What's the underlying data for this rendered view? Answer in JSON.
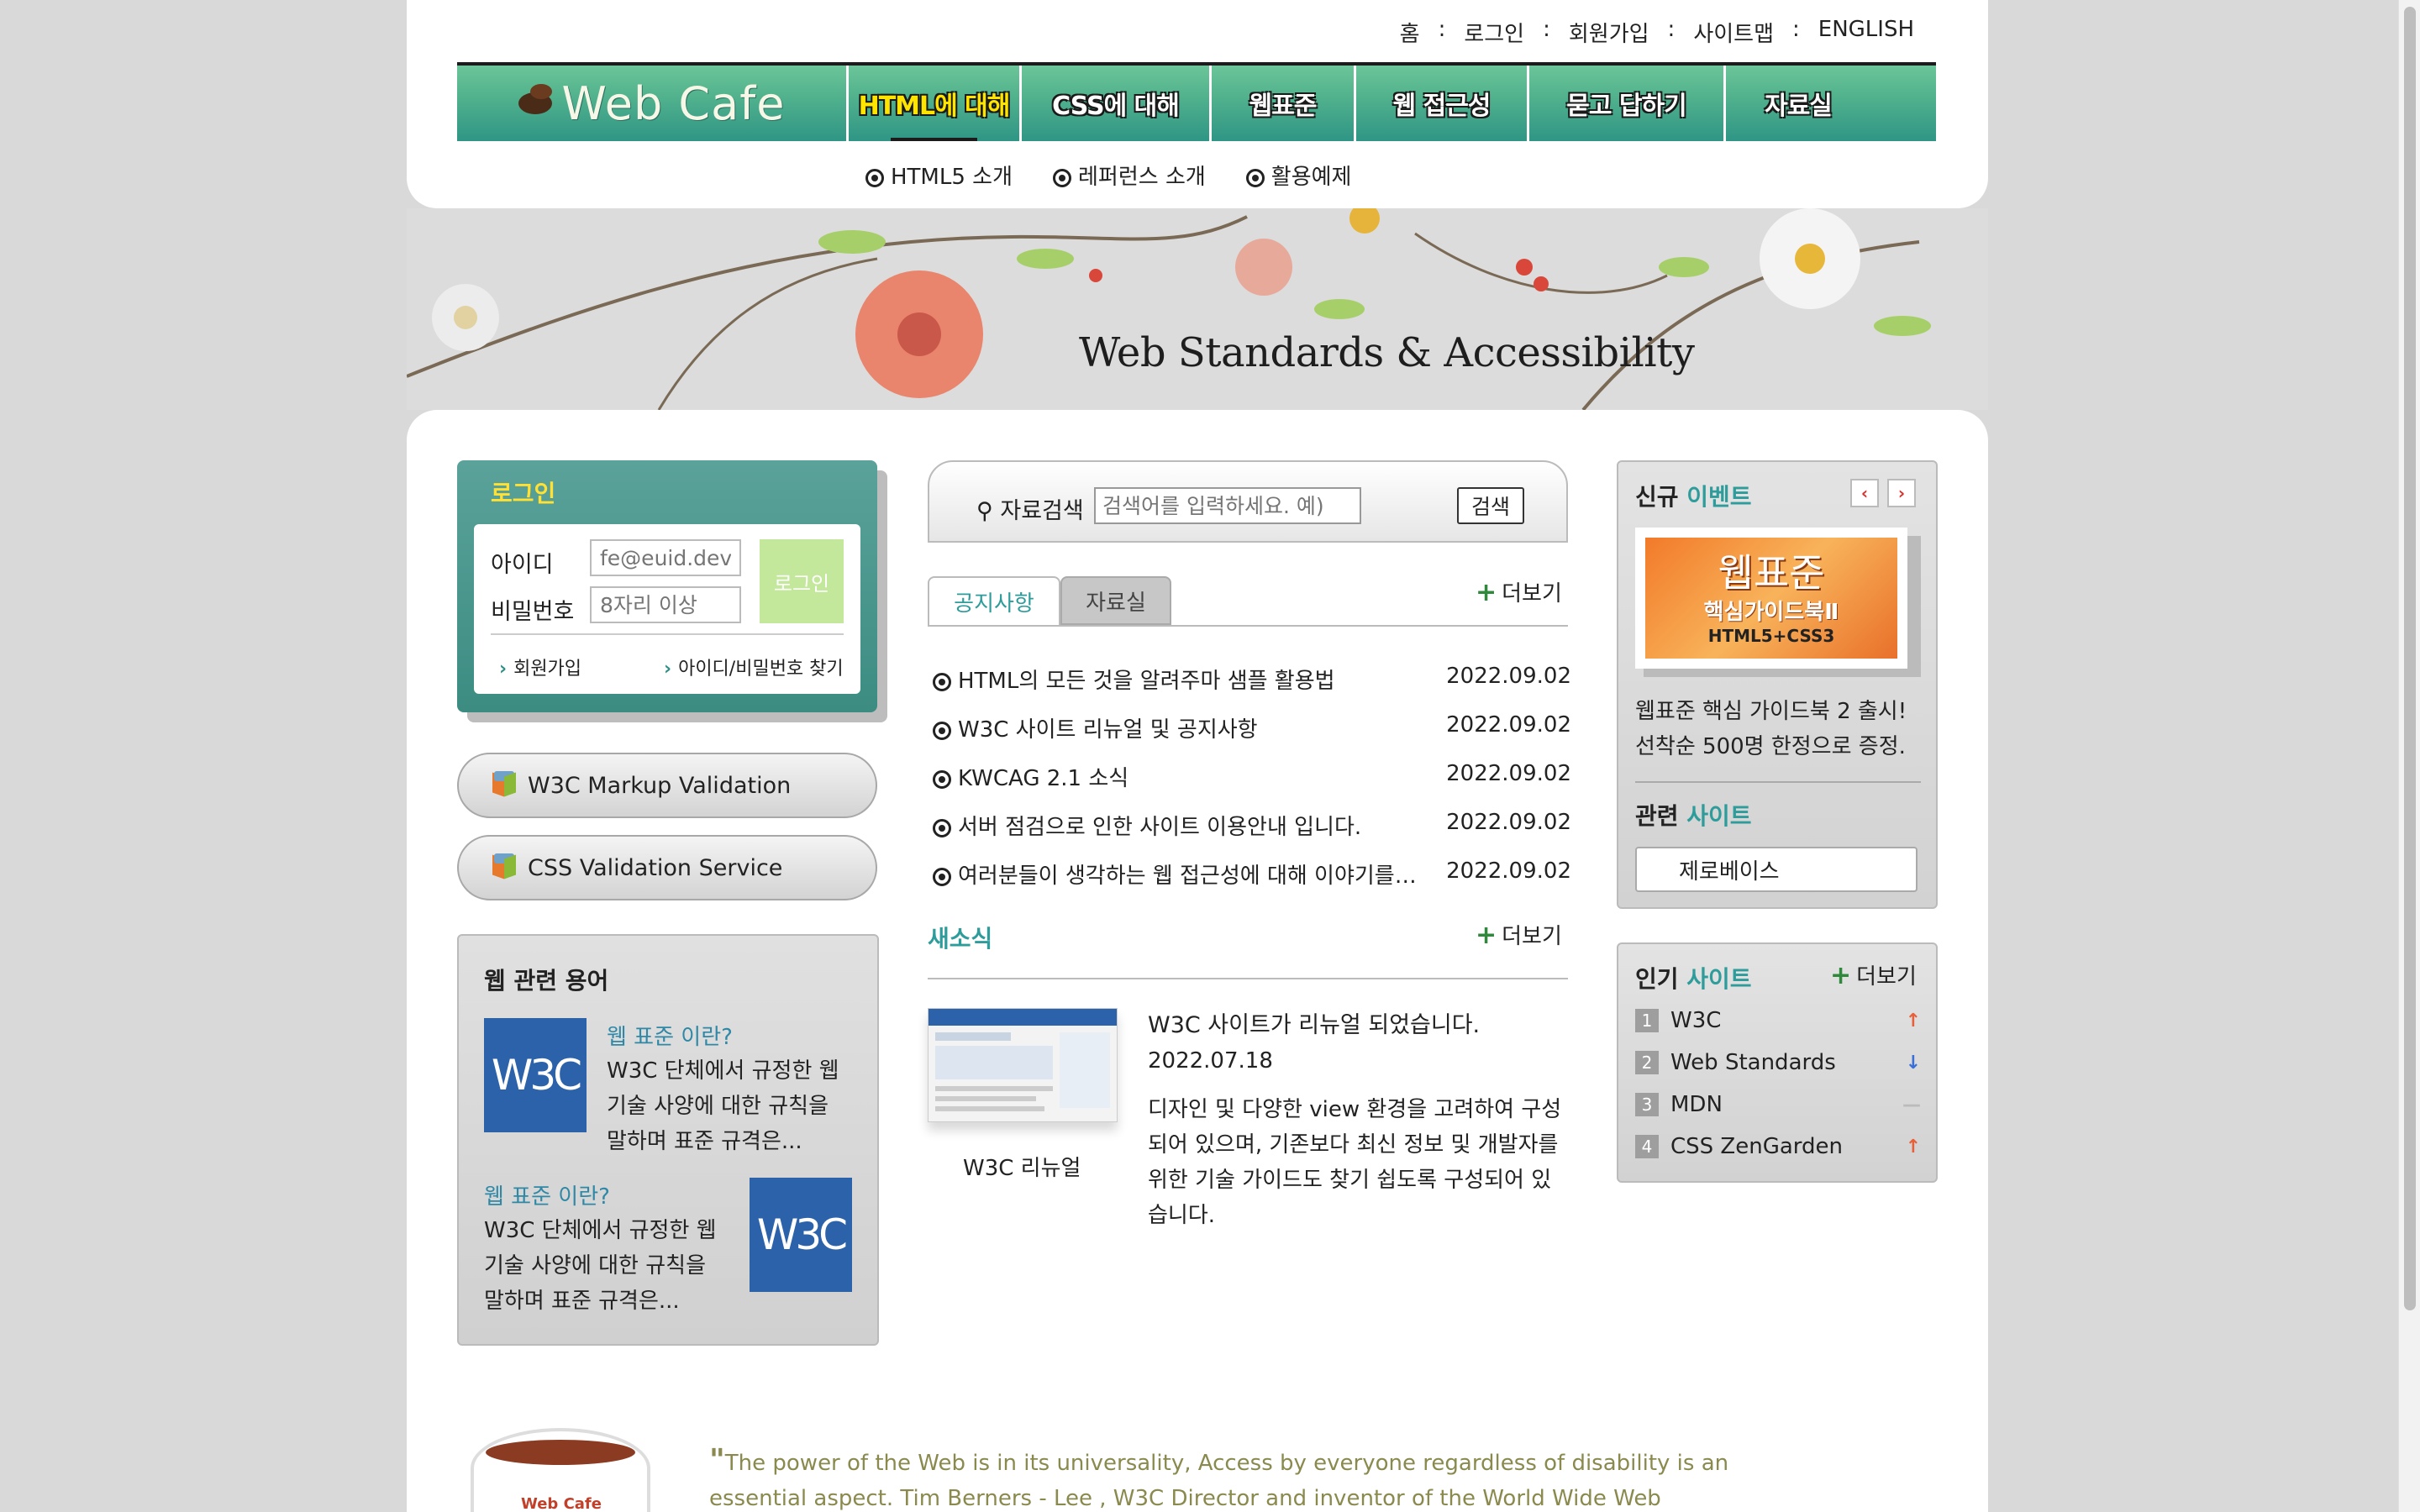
{
  "util_nav": [
    "홈",
    "로그인",
    "회원가입",
    "사이트맵",
    "ENGLISH"
  ],
  "util_sep": ":",
  "logo": "Web Cafe",
  "gnb": [
    "HTML에 대해",
    "CSS에 대해",
    "웹표준",
    "웹 접근성",
    "묻고 답하기",
    "자료실"
  ],
  "sub_nav": [
    "HTML5 소개",
    "레퍼런스 소개",
    "활용예제"
  ],
  "banner": {
    "title": "Web Standards & Accessibility"
  },
  "login": {
    "title": "로그인",
    "id_label": "아이디",
    "pw_label": "비밀번호",
    "id_placeholder": "fe@euid.dev",
    "pw_placeholder": "8자리 이상",
    "button": "로그인",
    "join": "회원가입",
    "find": "아이디/비밀번호 찾기"
  },
  "validation": [
    "W3C Markup Validation",
    "CSS Validation Service"
  ],
  "terms": {
    "title": "웹 관련 용어",
    "logo_text": "W3C",
    "items": [
      {
        "q": "웹 표준 이란?",
        "a1": "W3C 단체에서 규정한 웹",
        "a2": "기술 사양에 대한 규칙을",
        "a3": "말하며 표준 규격은..."
      },
      {
        "q": "웹 표준 이란?",
        "a1": "W3C 단체에서 규정한 웹",
        "a2": "기술 사양에 대한 규칙을",
        "a3": "말하며 표준 규격은..."
      }
    ]
  },
  "search": {
    "label": "자료검색",
    "placeholder": "검색어를 입력하세요. 예)",
    "button": "검색"
  },
  "tabs": [
    "공지사항",
    "자료실"
  ],
  "more_label": "더보기",
  "notices": [
    {
      "title": "HTML의 모든 것을 알려주마 샘플 활용법",
      "date": "2022.09.02"
    },
    {
      "title": "W3C 사이트 리뉴얼 및 공지사항",
      "date": "2022.09.02"
    },
    {
      "title": "KWCAG 2.1 소식",
      "date": "2022.09.02"
    },
    {
      "title": "서버 점검으로 인한 사이트 이용안내 입니다.",
      "date": "2022.09.02"
    },
    {
      "title": "여러분들이 생각하는 웹 접근성에 대해 이야기를 ...",
      "date": "2022.09.02"
    }
  ],
  "news": {
    "heading": "새소식",
    "caption": "W3C 리뉴얼",
    "title": "W3C 사이트가 리뉴얼 되었습니다.",
    "date": "2022.07.18",
    "body": "디자인 및 다양한 view 환경을 고려하여 구성되어 있으며, 기존보다 최신 정보 및 개발자를 위한 기술 가이드도 찾기 쉽도록 구성되어 있습니다."
  },
  "event": {
    "head_a": "신규",
    "head_b": "이벤트",
    "book_line1": "웹표준",
    "book_line2": "핵심가이드북Ⅱ",
    "book_line3": "HTML5+CSS3",
    "text1": "웹표준 핵심 가이드북 2 출시!",
    "text2": "선착순 500명 한정으로 증정.",
    "related_a": "관련",
    "related_b": "사이트",
    "related_value": "제로베이스"
  },
  "popular": {
    "head_a": "인기",
    "head_b": "사이트",
    "items": [
      {
        "rank": "1",
        "name": "W3C",
        "trend": "up"
      },
      {
        "rank": "2",
        "name": "Web Standards",
        "trend": "down"
      },
      {
        "rank": "3",
        "name": "MDN",
        "trend": "same"
      },
      {
        "rank": "4",
        "name": "CSS ZenGarden",
        "trend": "up"
      }
    ]
  },
  "footer": {
    "cup_label": "Web Cafe",
    "quote_mark": "\"",
    "quote": "The power of the Web is in its universality, Access by everyone regardless of disability is an essential aspect. Tim Berners - Lee , W3C Director and inventor of the World Wide Web"
  },
  "colors": {
    "accent": "#2e9c9a",
    "gnb": "#55b58e",
    "active": "#ffe400",
    "up": "#e8603a",
    "down": "#3a6fd8"
  }
}
